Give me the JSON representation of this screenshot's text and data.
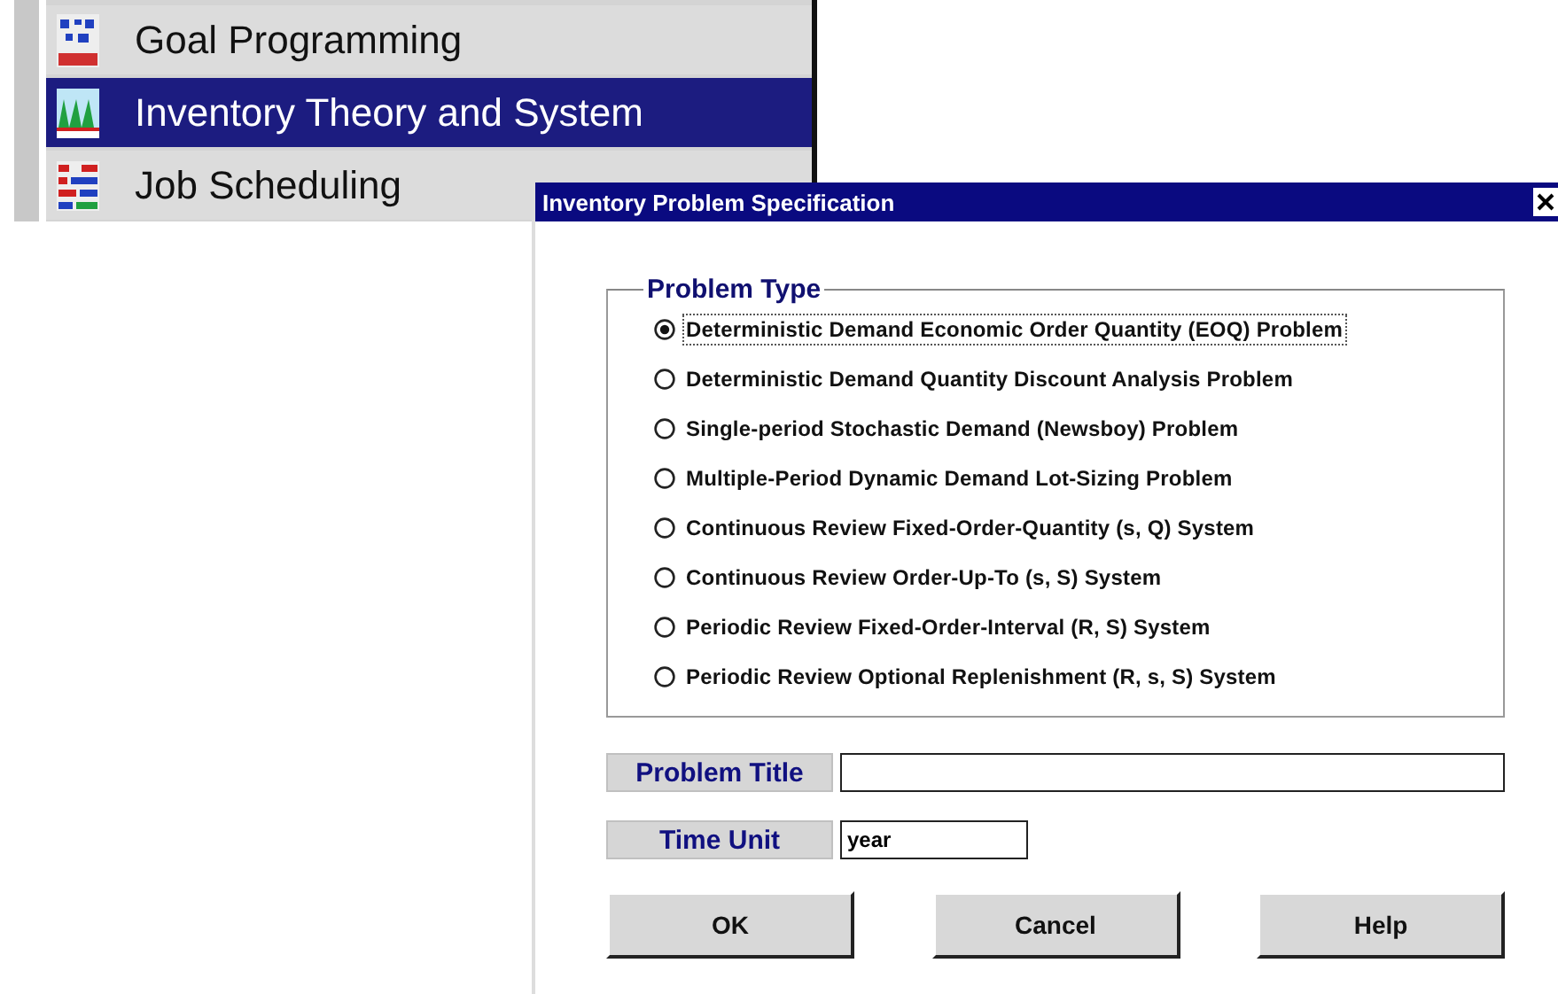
{
  "menu": {
    "items": [
      {
        "label": "Goal Programming",
        "selected": false,
        "kind": "goal"
      },
      {
        "label": "Inventory Theory and System",
        "selected": true,
        "kind": "inventory"
      },
      {
        "label": "Job Scheduling",
        "selected": false,
        "kind": "job"
      }
    ]
  },
  "dialog": {
    "title": "Inventory Problem Specification",
    "group_title": "Problem Type",
    "options": [
      {
        "label": "Deterministic Demand Economic Order Quantity (EOQ) Problem",
        "selected": true
      },
      {
        "label": "Deterministic Demand Quantity Discount Analysis Problem",
        "selected": false
      },
      {
        "label": "Single-period Stochastic Demand (Newsboy) Problem",
        "selected": false
      },
      {
        "label": "Multiple-Period Dynamic Demand Lot-Sizing Problem",
        "selected": false
      },
      {
        "label": "Continuous Review Fixed-Order-Quantity (s, Q) System",
        "selected": false
      },
      {
        "label": "Continuous Review Order-Up-To (s, S) System",
        "selected": false
      },
      {
        "label": "Periodic Review Fixed-Order-Interval (R, S) System",
        "selected": false
      },
      {
        "label": "Periodic Review Optional Replenishment (R, s, S) System",
        "selected": false
      }
    ],
    "problem_title": {
      "label": "Problem Title"
    },
    "time_unit": {
      "label": "Time Unit",
      "value": "year"
    },
    "buttons": [
      "OK",
      "Cancel",
      "Help"
    ]
  }
}
